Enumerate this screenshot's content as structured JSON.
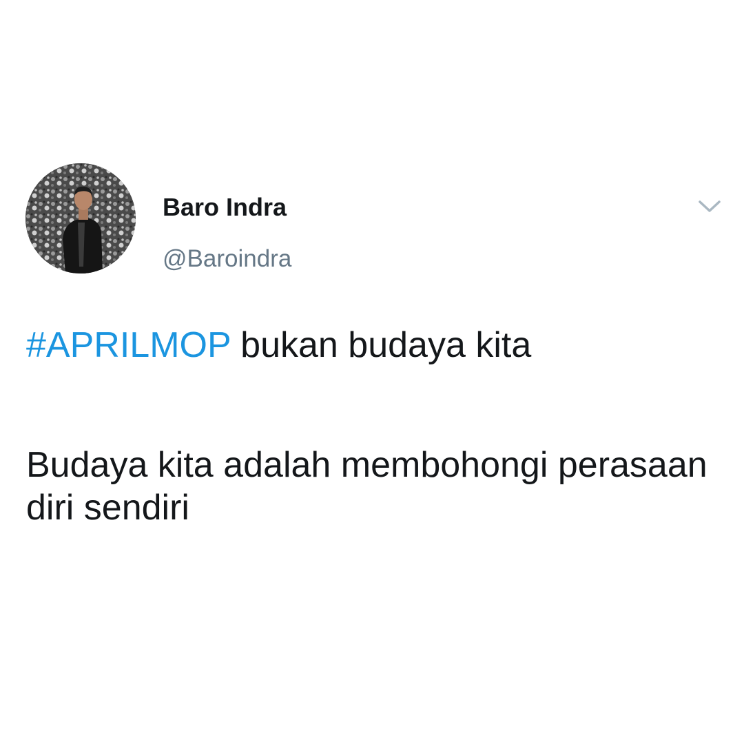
{
  "tweet": {
    "author": {
      "display_name": "Baro Indra",
      "handle": "@Baroindra",
      "avatar_icon": "user-avatar-photo"
    },
    "menu_icon": "chevron-down-icon",
    "text": {
      "hashtag": "#APRILMOP",
      "line1_rest": " bukan budaya kita",
      "paragraph2": "Budaya kita adalah membohongi perasaan diri sendiri"
    }
  },
  "colors": {
    "hashtag": "#1b95e0",
    "text": "#14171a",
    "handle": "#657786",
    "caret": "#aab8c2",
    "background": "#ffffff"
  }
}
